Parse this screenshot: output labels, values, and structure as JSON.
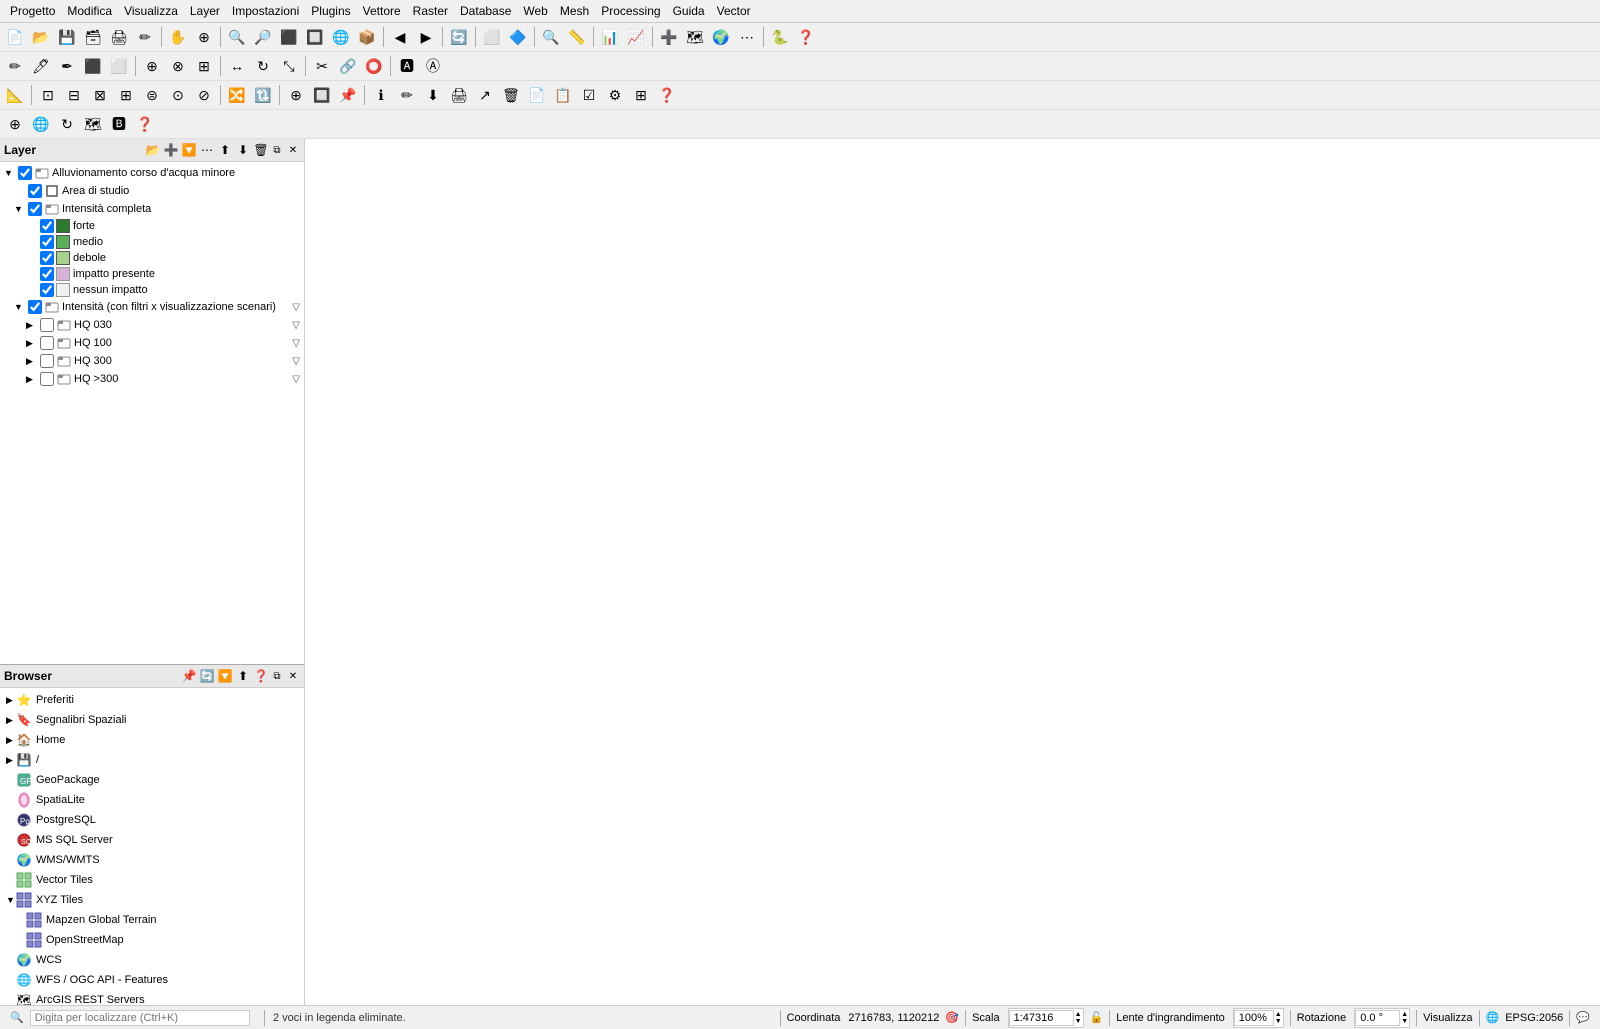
{
  "menubar": {
    "items": [
      "Progetto",
      "Modifica",
      "Visualizza",
      "Layer",
      "Impostazioni",
      "Plugins",
      "Vettore",
      "Raster",
      "Database",
      "Web",
      "Mesh",
      "Processing",
      "Guida",
      "Vector"
    ]
  },
  "layer_panel": {
    "title": "Layer",
    "tree": [
      {
        "id": "root",
        "indent": 0,
        "expanded": true,
        "checked": true,
        "icon": "group",
        "label": "Alluvionamento corso d'acqua minore",
        "hasArrow": true
      },
      {
        "id": "area_studio",
        "indent": 1,
        "expanded": false,
        "checked": true,
        "icon": "polygon",
        "label": "Area di studio",
        "hasArrow": false
      },
      {
        "id": "intensita_completa",
        "indent": 1,
        "expanded": true,
        "checked": true,
        "icon": "group",
        "label": "Intensità completa",
        "hasArrow": true
      },
      {
        "id": "forte",
        "indent": 2,
        "expanded": false,
        "checked": true,
        "color": "#2d7a2d",
        "label": "forte"
      },
      {
        "id": "medio",
        "indent": 2,
        "expanded": false,
        "checked": true,
        "color": "#5aad5a",
        "label": "medio"
      },
      {
        "id": "debole",
        "indent": 2,
        "expanded": false,
        "checked": true,
        "color": "#a8d08d",
        "label": "debole"
      },
      {
        "id": "impatto_presente",
        "indent": 2,
        "expanded": false,
        "checked": true,
        "color": "#d6b3d6",
        "label": "impatto presente"
      },
      {
        "id": "nessun_impatto",
        "indent": 2,
        "expanded": false,
        "checked": true,
        "color": "#f0f0f0",
        "label": "nessun impatto"
      },
      {
        "id": "intensita_scenari",
        "indent": 1,
        "expanded": true,
        "checked": true,
        "icon": "group",
        "label": "Intensità (con filtri x visualizzazione scenari)",
        "hasArrow": true,
        "hasFilter": true
      },
      {
        "id": "hq030",
        "indent": 2,
        "expanded": false,
        "checked": false,
        "icon": "group",
        "label": "HQ 030",
        "hasArrow": true,
        "hasFilter": true
      },
      {
        "id": "hq100",
        "indent": 2,
        "expanded": false,
        "checked": false,
        "icon": "group",
        "label": "HQ 100",
        "hasArrow": true,
        "hasFilter": true
      },
      {
        "id": "hq300",
        "indent": 2,
        "expanded": false,
        "checked": false,
        "icon": "group",
        "label": "HQ 300",
        "hasArrow": true,
        "hasFilter": true
      },
      {
        "id": "hq_over300",
        "indent": 2,
        "expanded": false,
        "checked": false,
        "icon": "group",
        "label": "HQ >300",
        "hasArrow": true,
        "hasFilter": true
      }
    ]
  },
  "browser_panel": {
    "title": "Browser",
    "items": [
      {
        "id": "preferiti",
        "icon": "star",
        "label": "Preferiti",
        "expandable": true,
        "expanded": false,
        "indent": 0
      },
      {
        "id": "segnalibri",
        "icon": "bookmark",
        "label": "Segnalibri Spaziali",
        "expandable": true,
        "expanded": false,
        "indent": 0
      },
      {
        "id": "home",
        "icon": "folder",
        "label": "Home",
        "expandable": true,
        "expanded": false,
        "indent": 0
      },
      {
        "id": "root_slash",
        "icon": "folder",
        "label": "/",
        "expandable": true,
        "expanded": false,
        "indent": 0
      },
      {
        "id": "geopackage",
        "icon": "geopackage",
        "label": "GeoPackage",
        "expandable": false,
        "indent": 0
      },
      {
        "id": "spatialite",
        "icon": "spatialite",
        "label": "SpatiaLite",
        "expandable": false,
        "indent": 0
      },
      {
        "id": "postgresql",
        "icon": "db",
        "label": "PostgreSQL",
        "expandable": false,
        "indent": 0
      },
      {
        "id": "mssql",
        "icon": "db",
        "label": "MS SQL Server",
        "expandable": false,
        "indent": 0
      },
      {
        "id": "wms_wmts",
        "icon": "wms",
        "label": "WMS/WMTS",
        "expandable": false,
        "indent": 0
      },
      {
        "id": "vector_tiles",
        "icon": "vtiles",
        "label": "Vector Tiles",
        "expandable": false,
        "indent": 0
      },
      {
        "id": "xyz_tiles",
        "icon": "xyz",
        "label": "XYZ Tiles",
        "expandable": true,
        "expanded": true,
        "indent": 0
      },
      {
        "id": "mapzen",
        "icon": "xyz_item",
        "label": "Mapzen Global Terrain",
        "expandable": false,
        "indent": 1
      },
      {
        "id": "osm",
        "icon": "xyz_item",
        "label": "OpenStreetMap",
        "expandable": false,
        "indent": 1
      },
      {
        "id": "wcs",
        "icon": "wcs",
        "label": "WCS",
        "expandable": false,
        "indent": 0
      },
      {
        "id": "wfs_ogc",
        "icon": "wfs",
        "label": "WFS / OGC API - Features",
        "expandable": false,
        "indent": 0
      },
      {
        "id": "arcgis_rest",
        "icon": "arcgis",
        "label": "ArcGIS REST Servers",
        "expandable": false,
        "indent": 0
      }
    ]
  },
  "statusbar": {
    "search_placeholder": "Digita per localizzare (Ctrl+K)",
    "message": "2 voci in legenda eliminate.",
    "coordinate_label": "Coordinata",
    "coordinate_value": "2716783, 1120212",
    "scale_label": "Scala",
    "scale_value": "1:47316",
    "magnifier_label": "Lente d'ingrandimento",
    "magnifier_value": "100%",
    "rotation_label": "Rotazione",
    "rotation_value": "0.0 °",
    "visualizza": "Visualizza",
    "epsg": "EPSG:2056"
  }
}
